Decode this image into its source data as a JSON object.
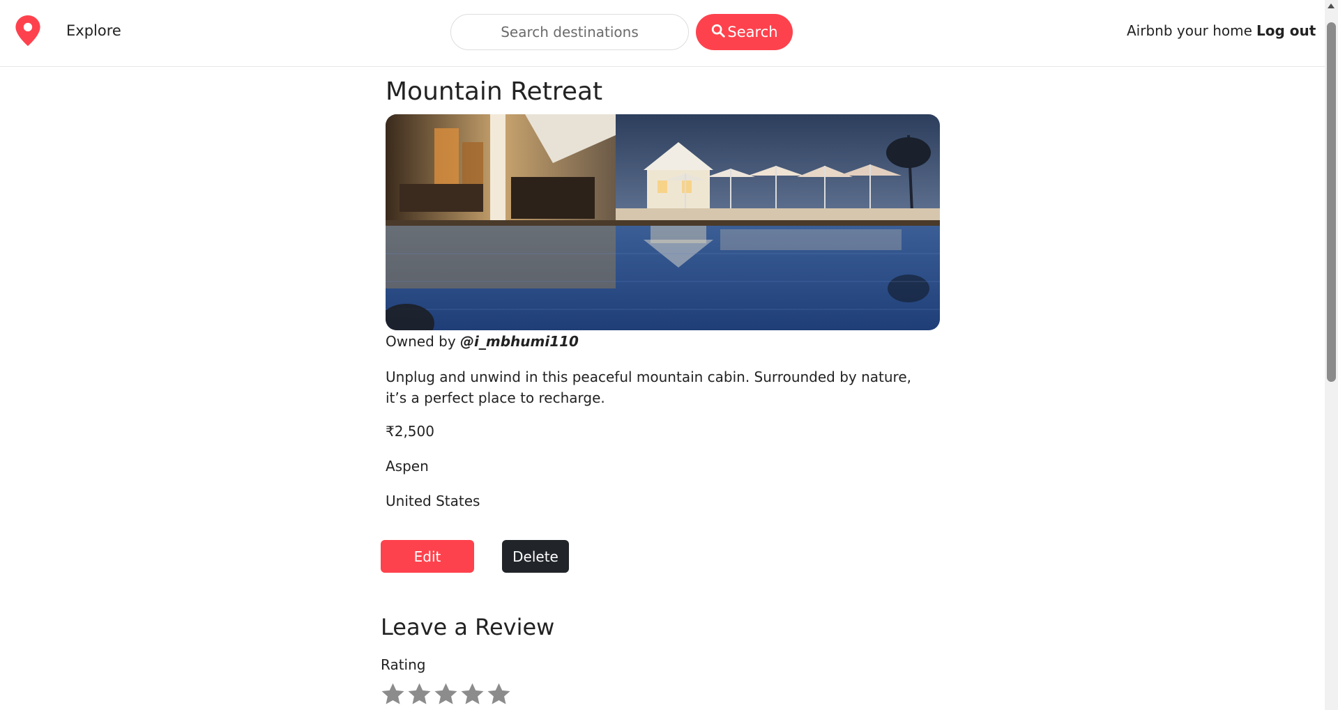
{
  "nav": {
    "explore_label": "Explore",
    "search_placeholder": "Search destinations",
    "search_button_label": "Search",
    "host_link": "Airbnb your home",
    "logout_label": "Log out"
  },
  "listing": {
    "title": "Mountain Retreat",
    "owner_prefix": "Owned by ",
    "owner_username": "@i_mbhumi110",
    "description": "Unplug and unwind in this peaceful mountain cabin. Surrounded by nature, it’s a perfect place to recharge.",
    "price": "₹2,500",
    "location": "Aspen",
    "country": "United States"
  },
  "actions": {
    "edit_label": "Edit",
    "delete_label": "Delete"
  },
  "review": {
    "heading": "Leave a Review",
    "rating_label": "Rating",
    "star_count": 5
  },
  "colors": {
    "brand": "#fe424d",
    "dark_button": "#212529",
    "star_empty": "#8c8c8c"
  },
  "icons": {
    "logo": "map-pin-icon",
    "search": "magnifier-icon",
    "star": "star-icon"
  }
}
